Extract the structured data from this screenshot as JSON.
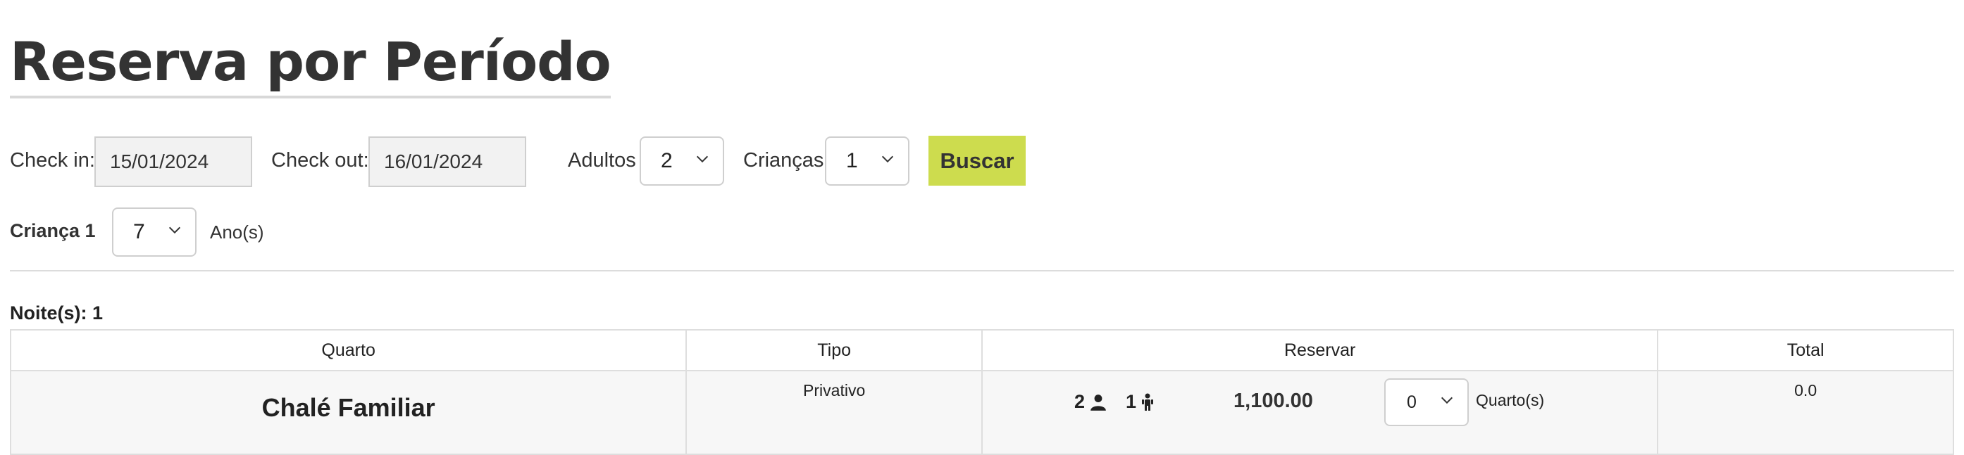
{
  "page": {
    "title": "Reserva por Período"
  },
  "search": {
    "checkin_label": "Check in:",
    "checkin_value": "15/01/2024",
    "checkout_label": "Check out:",
    "checkout_value": "16/01/2024",
    "adults_label": "Adultos",
    "adults_value": "2",
    "children_label": "Crianças",
    "children_value": "1",
    "search_button": "Buscar"
  },
  "child_ages": {
    "child1_label": "Criança 1",
    "child1_age": "7",
    "age_unit": "Ano(s)"
  },
  "results": {
    "nights_label": "Noite(s): 1",
    "columns": [
      "Quarto",
      "Tipo",
      "Reservar",
      "Total"
    ],
    "rows": [
      {
        "room": "Chalé Familiar",
        "type": "Privativo",
        "adults": "2",
        "children": "1",
        "price": "1,100.00",
        "quantity": "0",
        "quantity_unit": "Quarto(s)",
        "total": "0.0"
      }
    ]
  },
  "colors": {
    "accent_button": "#cddc4e",
    "text": "#333333"
  },
  "icons": [
    "chevron-down-icon",
    "adult-icon",
    "child-icon"
  ]
}
